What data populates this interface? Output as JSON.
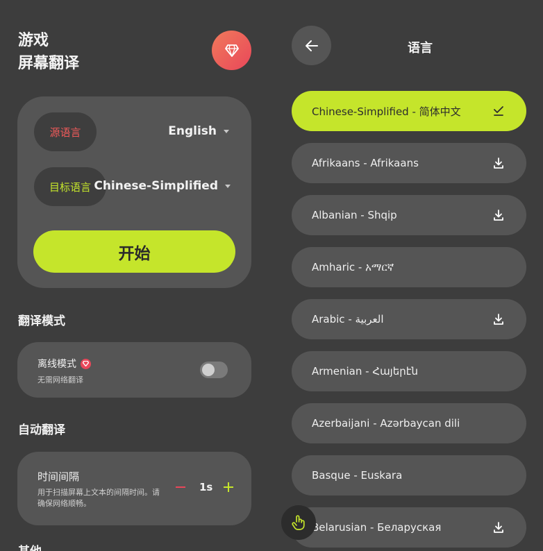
{
  "app": {
    "title_line1": "游戏",
    "title_line2": "屏幕翻译"
  },
  "source": {
    "label": "源语言",
    "value": "English"
  },
  "target": {
    "label": "目标语言",
    "value": "Chinese-Simplified"
  },
  "start_button": "开始",
  "sections": {
    "mode": "翻译模式",
    "auto": "自动翻译",
    "other": "其他"
  },
  "offline": {
    "title": "离线模式",
    "subtitle": "无需网络翻译",
    "enabled": false
  },
  "interval": {
    "title": "时间间隔",
    "description": "用于扫描屏幕上文本的间隔时间。请确保网络顺畅。",
    "value": "1s"
  },
  "language_page": {
    "title": "语言"
  },
  "languages": [
    {
      "label": "Chinese-Simplified - 简体中文",
      "icon": "check-icon",
      "selected": true
    },
    {
      "label": "Afrikaans - Afrikaans",
      "icon": "download-icon",
      "selected": false
    },
    {
      "label": "Albanian - Shqip",
      "icon": "download-icon",
      "selected": false
    },
    {
      "label": "Amharic - አማርኛ",
      "icon": "",
      "selected": false
    },
    {
      "label": "Arabic - العربية",
      "icon": "download-icon",
      "selected": false
    },
    {
      "label": "Armenian - Հայերէն",
      "icon": "",
      "selected": false
    },
    {
      "label": "Azerbaijani - Azərbaycan dili",
      "icon": "",
      "selected": false
    },
    {
      "label": "Basque - Euskara",
      "icon": "",
      "selected": false
    },
    {
      "label": "Belarusian - Беларуская",
      "icon": "download-icon",
      "selected": false
    }
  ],
  "colors": {
    "accent": "#c5e52b",
    "danger": "#e9475a",
    "background": "#3d3d3d",
    "card": "#555555"
  }
}
